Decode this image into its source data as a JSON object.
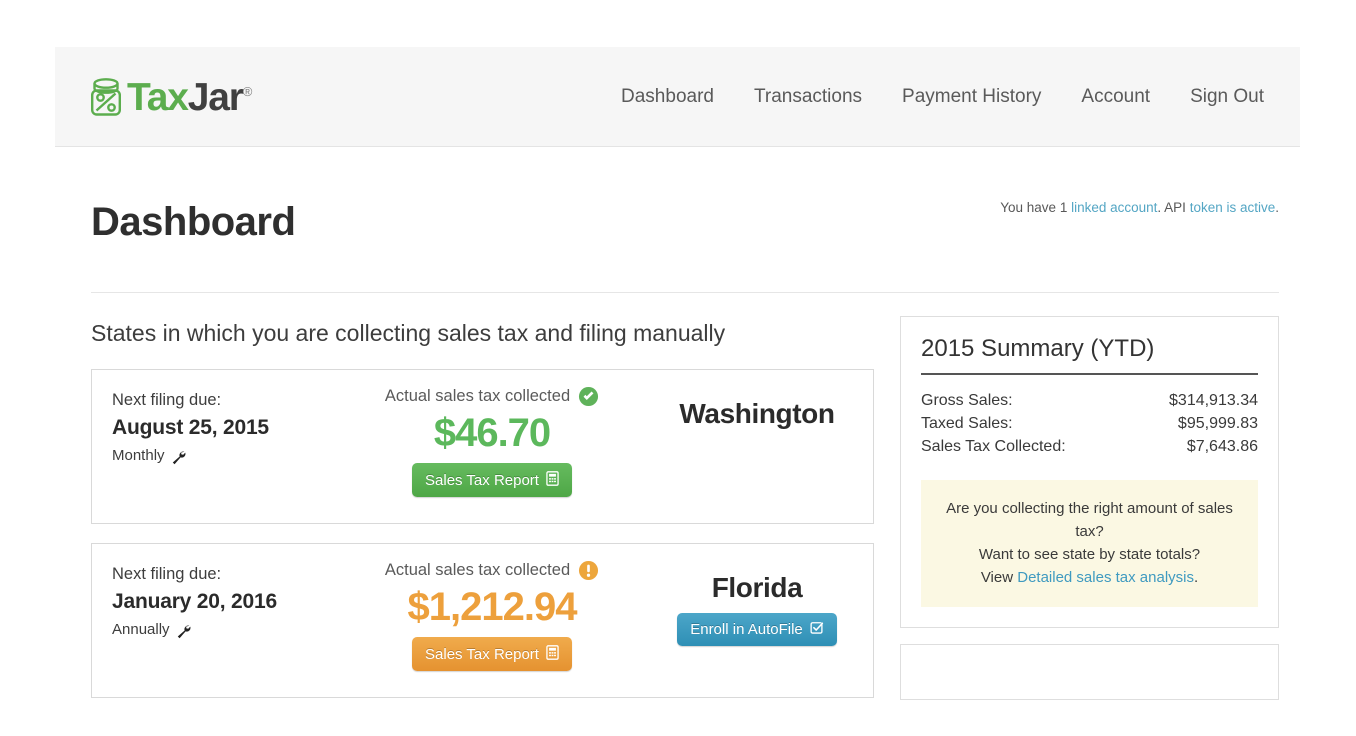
{
  "brand": {
    "name_part1": "Tax",
    "name_part2": "Jar",
    "registered_mark": "®",
    "logo_icon": "tax-jar-logo-icon"
  },
  "nav": {
    "links": [
      {
        "label": "Dashboard"
      },
      {
        "label": "Transactions"
      },
      {
        "label": "Payment History"
      },
      {
        "label": "Account"
      },
      {
        "label": "Sign Out"
      }
    ]
  },
  "header": {
    "page_title": "Dashboard",
    "account_note": {
      "text_1": "You have ",
      "count": "1",
      "link_1": "linked account",
      "text_2": ". API ",
      "link_2": "token is active",
      "text_3": "."
    }
  },
  "main": {
    "section_title": "States in which you are collecting sales tax and filing manually",
    "cards": [
      {
        "due_label": "Next filing due:",
        "due_date": "August 25, 2015",
        "frequency": "Monthly",
        "frequency_icon": "wrench-icon",
        "amount_label": "Actual sales tax collected",
        "status_icon": "check-circle-icon",
        "status": "ok",
        "amount": "$46.70",
        "amount_color": "#5cb85c",
        "report_button": "Sales Tax Report",
        "report_button_icon": "report-document-icon",
        "state": "Washington",
        "action_button": null,
        "action_button_icon": null
      },
      {
        "due_label": "Next filing due:",
        "due_date": "January 20, 2016",
        "frequency": "Annually",
        "frequency_icon": "wrench-icon",
        "amount_label": "Actual sales tax collected",
        "status_icon": "exclamation-circle-icon",
        "status": "warning",
        "amount": "$1,212.94",
        "amount_color": "#eda03c",
        "report_button": "Sales Tax Report",
        "report_button_icon": "report-document-icon",
        "state": "Florida",
        "action_button": "Enroll in AutoFile",
        "action_button_icon": "check-square-icon"
      }
    ]
  },
  "sidebar": {
    "summary": {
      "title": "2015 Summary (YTD)",
      "rows": [
        {
          "label": "Gross Sales:",
          "value": "$314,913.34"
        },
        {
          "label": "Taxed Sales:",
          "value": "$95,999.83"
        },
        {
          "label": "Sales Tax Collected:",
          "value": "$7,643.86"
        }
      ],
      "callout": {
        "line1": "Are you collecting the right amount of sales tax?",
        "line2": "Want to see state by state totals?",
        "line3_prefix": "View ",
        "line3_link": "Detailed sales tax analysis",
        "line3_suffix": "."
      }
    }
  },
  "colors": {
    "brand_green": "#5cad4e",
    "accent_blue": "#54a6c4",
    "warning_orange": "#eda03c",
    "success_green": "#5cb85c",
    "callout_bg": "#fbf8e3",
    "navbar_bg": "#f6f6f6"
  }
}
